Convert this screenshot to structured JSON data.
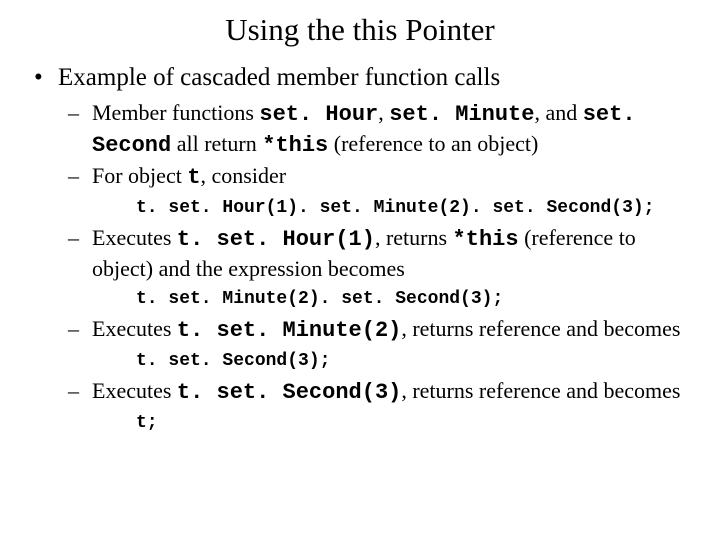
{
  "title": "Using the this Pointer",
  "bullet1_text": "Example of cascaded member function calls",
  "sub1_a": "Member functions ",
  "sub1_m1": "set. Hour",
  "sub1_b": ", ",
  "sub1_m2": "set. Minute",
  "sub1_c": ", and ",
  "sub1_m3": "set. Second",
  "sub1_d": " all return ",
  "sub1_m4": "*this",
  "sub1_e": " (reference to an object)",
  "sub2_a": "For object ",
  "sub2_m1": "t",
  "sub2_b": ", consider",
  "code1": "t. set. Hour(1). set. Minute(2). set. Second(3);",
  "sub3_a": "Executes ",
  "sub3_m1": "t. set. Hour(1)",
  "sub3_b": ", returns ",
  "sub3_m2": "*this",
  "sub3_c": " (reference to object) and the expression becomes",
  "code2": "t. set. Minute(2). set. Second(3);",
  "sub4_a": "Executes ",
  "sub4_m1": "t. set. Minute(2)",
  "sub4_b": ", returns reference and becomes",
  "code3": "t. set. Second(3);",
  "sub5_a": "Executes ",
  "sub5_m1": "t. set. Second(3)",
  "sub5_b": ", returns reference and becomes",
  "code4": "t;"
}
